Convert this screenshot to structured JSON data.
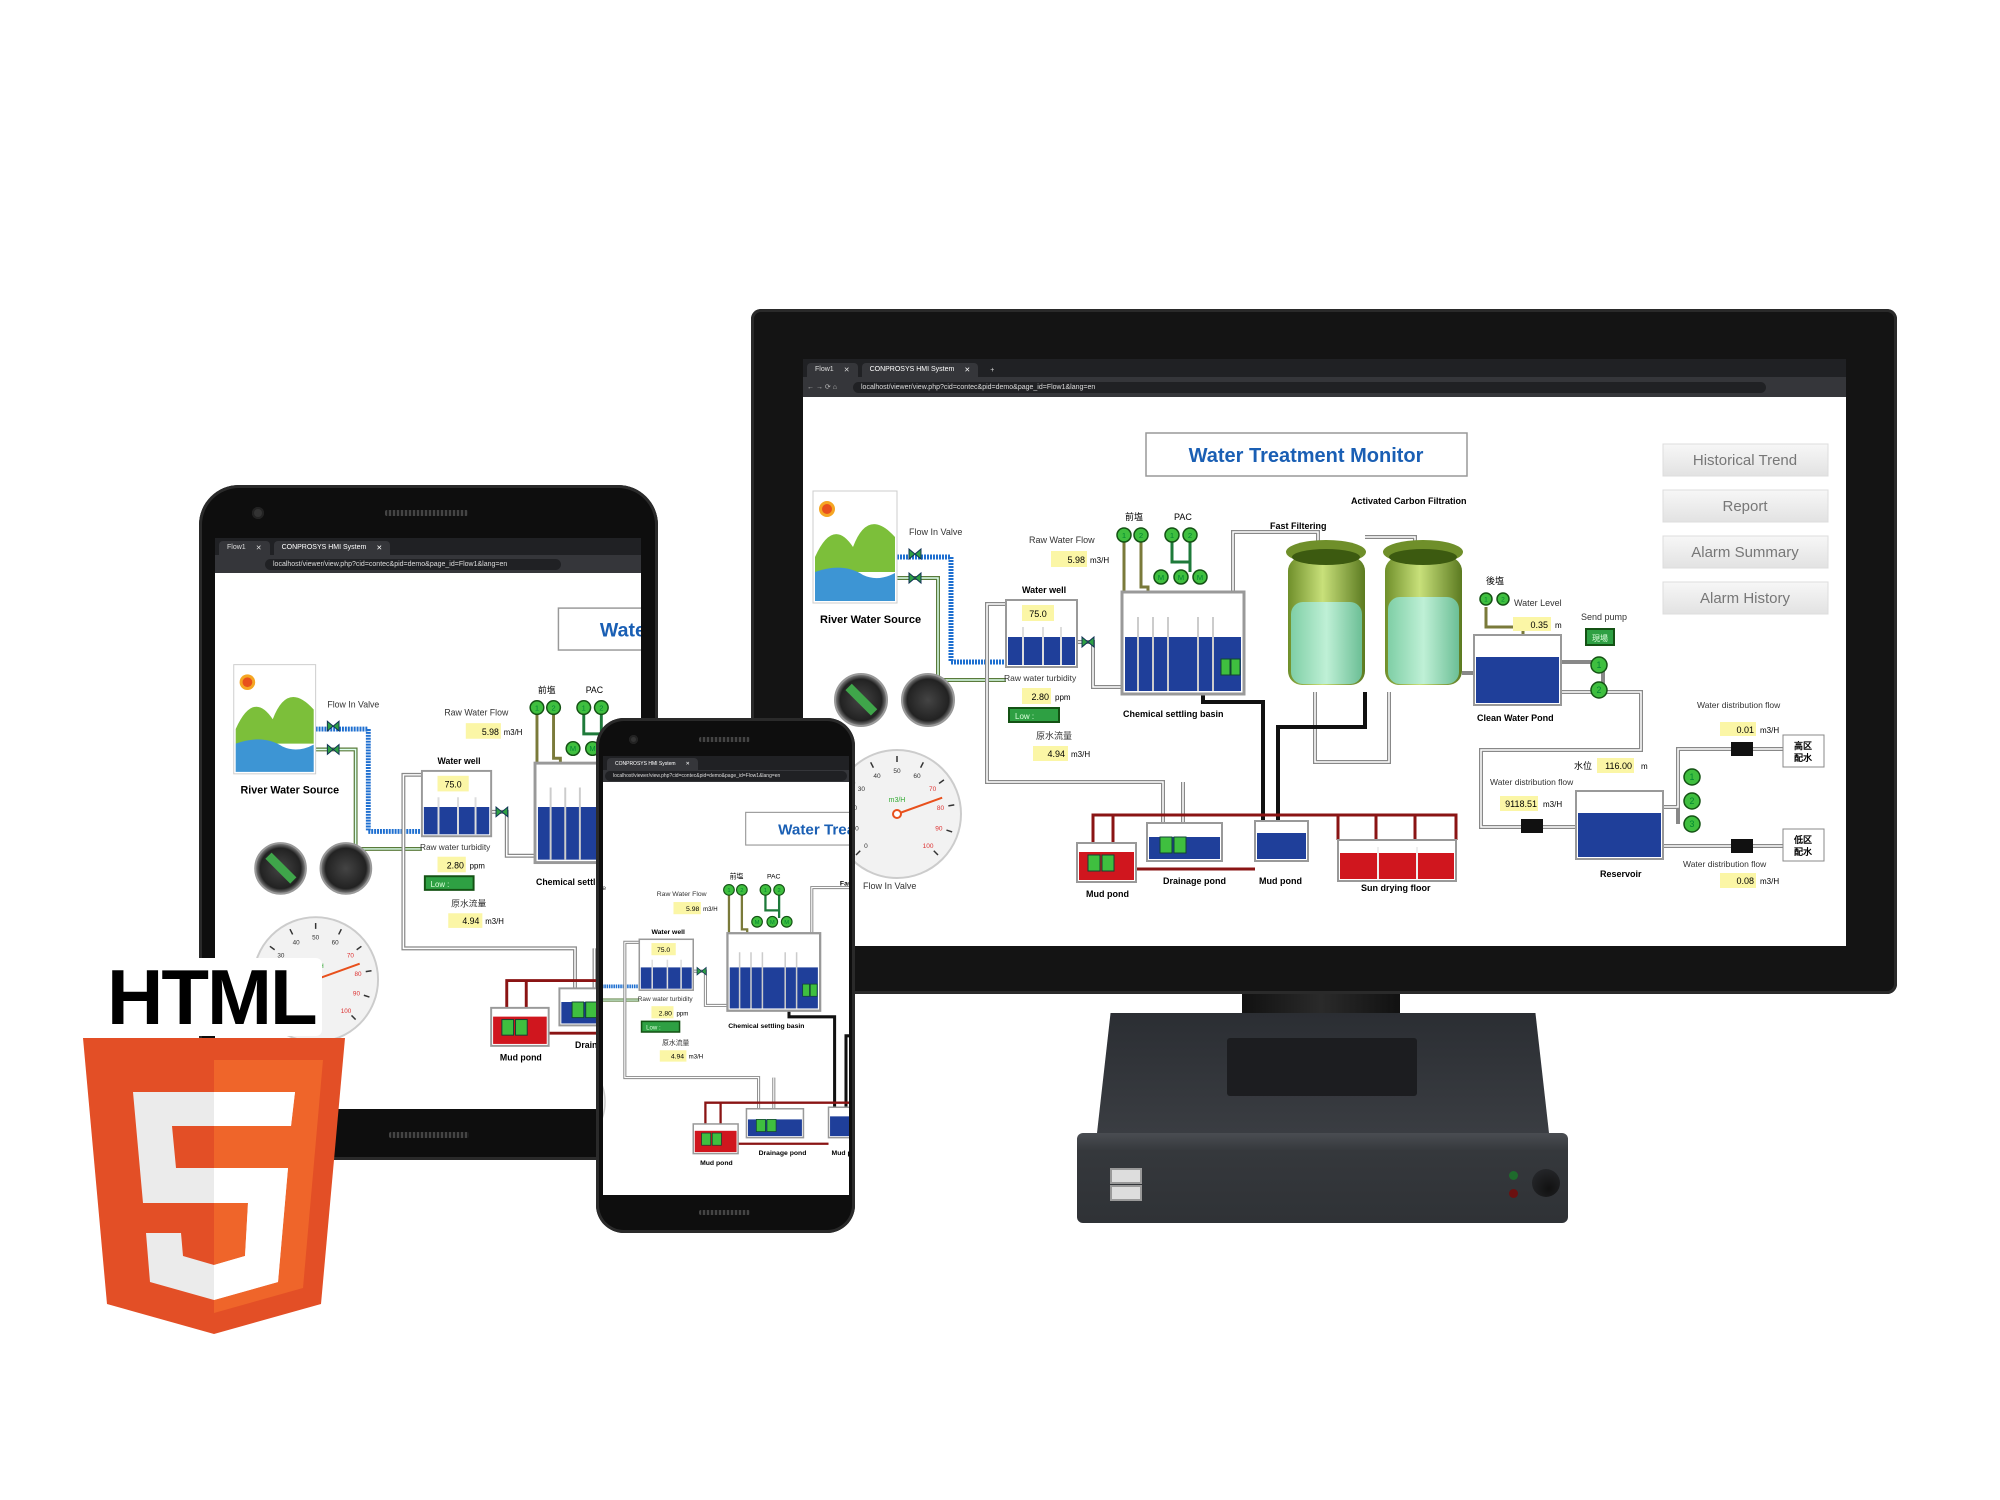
{
  "browser": {
    "tabs": [
      "Flow1",
      "CONPROSYS HMI System"
    ],
    "new_tab": "+",
    "url": "localhost/viewer/view.php?cid=contec&pid=demo&page_id=Flow1&lang=en"
  },
  "hmi": {
    "title": "Water Treatment Monitor",
    "buttons": [
      "Historical Trend",
      "Report",
      "Alarm Summary",
      "Alarm History"
    ],
    "river_label": "River Water Source",
    "flow_in_valve": "Flow In Valve",
    "raw_water_flow_label": "Raw Water Flow",
    "raw_water_flow": "5.98",
    "unit_flow": "m3/H",
    "water_well_label": "Water well",
    "water_well_value": "75.0",
    "turbidity_label": "Raw water turbidity",
    "turbidity": "2.80",
    "unit_ppm": "ppm",
    "turbidity_status": "Low  :",
    "raw_flow_jp_label": "原水流量",
    "raw_flow_jp": "4.94",
    "pre_chlorine": "前塩",
    "pac": "PAC",
    "motor": "M",
    "chem_basin_label": "Chemical settling basin",
    "fast_filtering": "Fast Filtering",
    "activated_carbon": "Activated Carbon Filtration",
    "post_chlorine": "後塩",
    "water_level_label": "Water Level",
    "water_level": "0.35",
    "unit_m": "m",
    "send_pump_label": "Send pump",
    "send_pump_mode": "現場",
    "clean_pond_label": "Clean Water Pond",
    "dist_flow_label": "Water distribution flow",
    "dist_flow_high": "0.01",
    "high_zone": [
      "高区",
      "配水"
    ],
    "reservoir_level_label": "水位",
    "reservoir_level": "116.00",
    "dist_flow_main": "9118.51",
    "reservoir_label": "Reservoir",
    "dist_flow_low": "0.08",
    "low_zone": [
      "低区",
      "配水"
    ],
    "mud_pond_label": "Mud pond",
    "drainage_pond_label": "Drainage pond",
    "sun_drying_label": "Sun drying floor",
    "pump_numbers": [
      "1",
      "2",
      "3"
    ],
    "gauge": {
      "unit": "m3/H",
      "ticks": [
        "0",
        "10",
        "20",
        "30",
        "40",
        "50",
        "60",
        "70",
        "80",
        "90",
        "100"
      ],
      "min": 0,
      "max": 100,
      "value": 76
    },
    "colors": {
      "title": "#1a5fb4",
      "water": "#1f3f9a",
      "value_box": "#fbf6a6",
      "pump": "#3fbf3f",
      "mud": "#d0161e"
    }
  },
  "logo": {
    "text": "HTML",
    "number": "5",
    "colors": {
      "dark": "#e34f26",
      "light": "#ef652a"
    }
  }
}
